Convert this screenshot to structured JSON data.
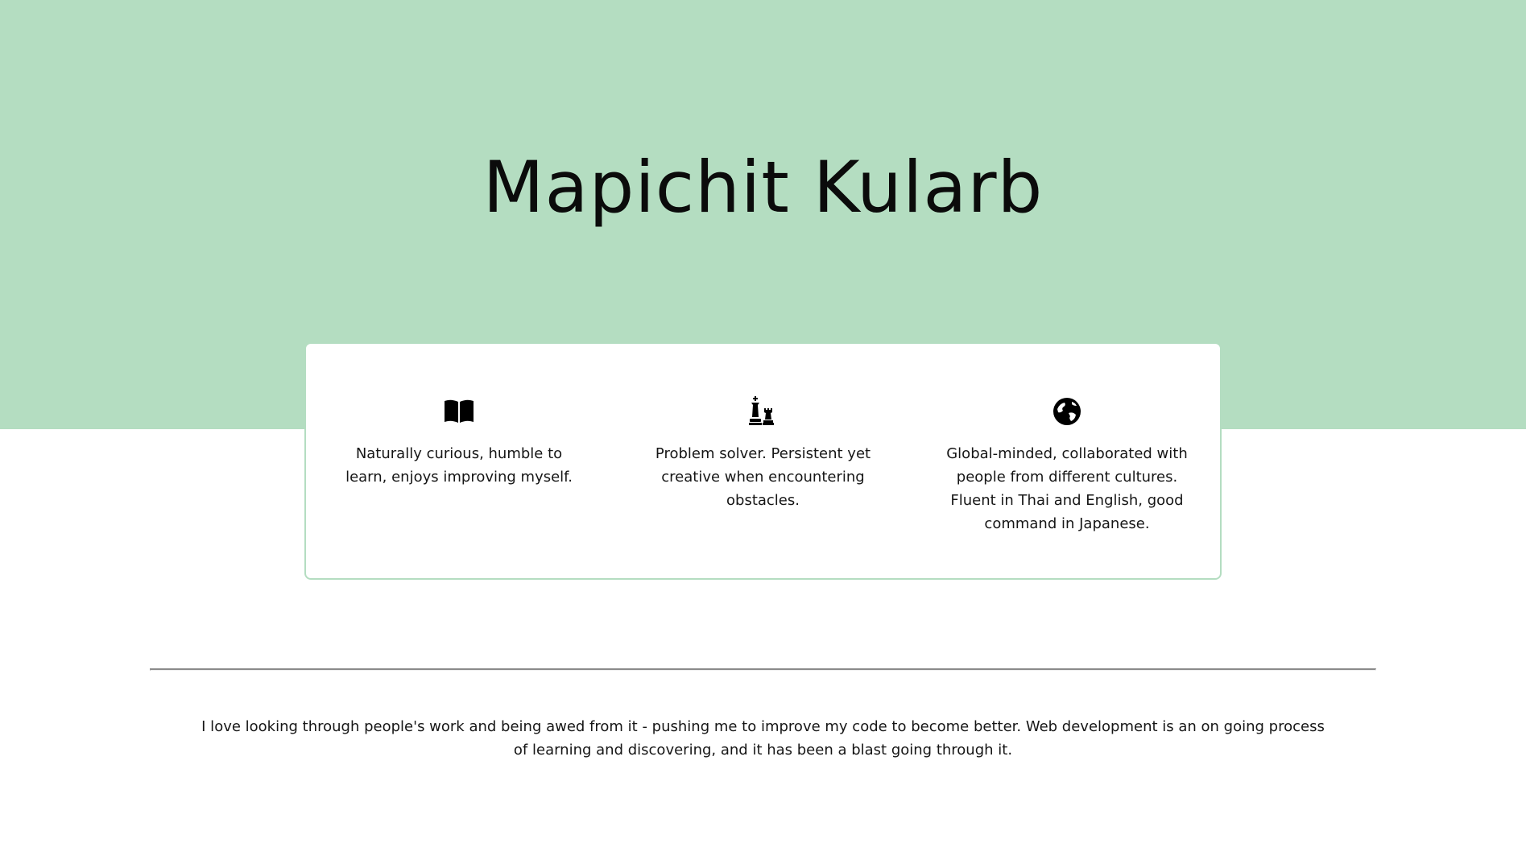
{
  "hero": {
    "name": "Mapichit Kularb"
  },
  "colors": {
    "hero_background": "#b4ddc1",
    "card_border": "#b4ddc1",
    "divider": "#8a8a8a"
  },
  "features": [
    {
      "icon": "open-book-icon",
      "text": "Naturally curious, humble to learn, enjoys improving myself."
    },
    {
      "icon": "chess-pieces-icon",
      "text": "Problem solver. Persistent yet creative when encountering obstacles."
    },
    {
      "icon": "globe-icon",
      "text": "Global-minded, collaborated with people from different cultures. Fluent in Thai and English, good command in Japanese."
    }
  ],
  "about": {
    "text": "I love looking through people's work and being awed from it - pushing me to improve my code to become better. Web development is an on going process of learning and discovering, and it has been a blast going through it."
  }
}
